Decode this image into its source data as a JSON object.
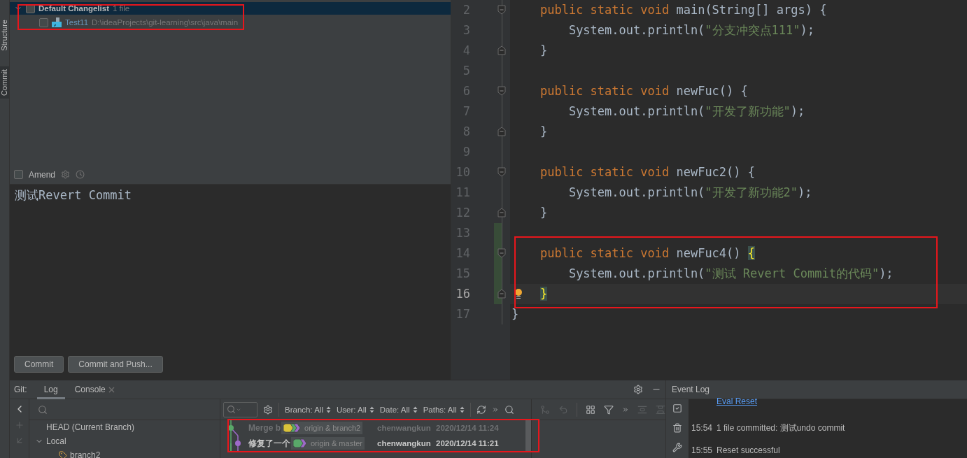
{
  "tool_strip": [
    {
      "label": "Structure",
      "selected": false
    },
    {
      "label": "Commit",
      "selected": true
    }
  ],
  "changelist": {
    "name": "Default Changelist",
    "count": "1 file",
    "expanded": true,
    "checked": false,
    "selected": true,
    "highlighted": true,
    "files": [
      {
        "name": "Test11",
        "path": "D:\\ideaProjects\\git-learning\\src\\java\\main",
        "checked": false
      }
    ]
  },
  "amend": {
    "label": "Amend",
    "checked": false
  },
  "commit_message": "测试Revert Commit",
  "commit_buttons": [
    "Commit",
    "Commit and Push..."
  ],
  "editor": {
    "lines": [
      {
        "number": "2",
        "fold_start": true,
        "fold_end": false,
        "changed": false,
        "current": false,
        "highlighted": false,
        "tokens": [
          {
            "kind": "keyword",
            "text": "    public static void"
          },
          {
            "kind": "plain",
            "text": " main(String[] args) {"
          }
        ]
      },
      {
        "number": "3",
        "fold_start": false,
        "fold_end": false,
        "changed": false,
        "current": false,
        "highlighted": false,
        "tokens": [
          {
            "kind": "plain",
            "text": "        System.out.println("
          },
          {
            "kind": "string",
            "text": "\"分支冲突点111\""
          },
          {
            "kind": "plain",
            "text": ");"
          }
        ]
      },
      {
        "number": "4",
        "fold_start": false,
        "fold_end": true,
        "changed": false,
        "current": false,
        "highlighted": false,
        "tokens": [
          {
            "kind": "plain",
            "text": "    }"
          }
        ]
      },
      {
        "number": "5",
        "fold_start": false,
        "fold_end": false,
        "changed": false,
        "current": false,
        "highlighted": false
      },
      {
        "number": "6",
        "fold_start": true,
        "fold_end": false,
        "changed": false,
        "current": false,
        "highlighted": false,
        "tokens": [
          {
            "kind": "keyword",
            "text": "    public static void"
          },
          {
            "kind": "plain",
            "text": " newFuc() {"
          }
        ]
      },
      {
        "number": "7",
        "fold_start": false,
        "fold_end": false,
        "changed": false,
        "current": false,
        "highlighted": false,
        "tokens": [
          {
            "kind": "plain",
            "text": "        System.out.println("
          },
          {
            "kind": "string",
            "text": "\"开发了新功能\""
          },
          {
            "kind": "plain",
            "text": ");"
          }
        ]
      },
      {
        "number": "8",
        "fold_start": false,
        "fold_end": true,
        "changed": false,
        "current": false,
        "highlighted": false,
        "tokens": [
          {
            "kind": "plain",
            "text": "    }"
          }
        ]
      },
      {
        "number": "9",
        "fold_start": false,
        "fold_end": false,
        "changed": false,
        "current": false,
        "highlighted": false
      },
      {
        "number": "10",
        "fold_start": true,
        "fold_end": false,
        "changed": false,
        "current": false,
        "highlighted": false,
        "tokens": [
          {
            "kind": "keyword",
            "text": "    public static void"
          },
          {
            "kind": "plain",
            "text": " newFuc2() {"
          }
        ]
      },
      {
        "number": "11",
        "fold_start": false,
        "fold_end": false,
        "changed": false,
        "current": false,
        "highlighted": false,
        "tokens": [
          {
            "kind": "plain",
            "text": "        System.out.println("
          },
          {
            "kind": "string",
            "text": "\"开发了新功能2\""
          },
          {
            "kind": "plain",
            "text": ");"
          }
        ]
      },
      {
        "number": "12",
        "fold_start": false,
        "fold_end": true,
        "changed": false,
        "current": false,
        "highlighted": false,
        "tokens": [
          {
            "kind": "plain",
            "text": "    }"
          }
        ]
      },
      {
        "number": "13",
        "fold_start": false,
        "fold_end": false,
        "changed": true,
        "current": false,
        "highlighted": false
      },
      {
        "number": "14",
        "fold_start": true,
        "fold_end": false,
        "changed": true,
        "current": false,
        "highlighted": true,
        "tokens": [
          {
            "kind": "keyword",
            "text": "    public static void"
          },
          {
            "kind": "plain",
            "text": " newFuc4() "
          },
          {
            "kind": "brace_match",
            "text": "{"
          }
        ]
      },
      {
        "number": "15",
        "fold_start": false,
        "fold_end": false,
        "changed": true,
        "current": false,
        "highlighted": true,
        "tokens": [
          {
            "kind": "plain",
            "text": "        System.out.println("
          },
          {
            "kind": "string",
            "text": "\"测试 Revert Commit的代码\""
          },
          {
            "kind": "plain",
            "text": ");"
          }
        ]
      },
      {
        "number": "16",
        "fold_start": false,
        "fold_end": true,
        "changed": true,
        "current": true,
        "highlighted": true,
        "tokens": [
          {
            "kind": "brace_match",
            "text": "    }"
          }
        ]
      },
      {
        "number": "17",
        "fold_start": false,
        "fold_end": false,
        "changed": false,
        "current": false,
        "highlighted": false,
        "tokens": [
          {
            "kind": "plain",
            "text": "}"
          }
        ]
      }
    ]
  },
  "bottom_panel": {
    "title": "Git:",
    "tabs": [
      {
        "label": "Log",
        "selected": true,
        "closable": false
      },
      {
        "label": "Console",
        "selected": false,
        "closable": true
      }
    ]
  },
  "branches": [
    {
      "label": "HEAD (Current Branch)",
      "kind": "head"
    },
    {
      "label": "Local",
      "kind": "group",
      "expanded": true,
      "children": [
        {
          "label": "branch2",
          "kind": "branch"
        }
      ]
    }
  ],
  "log_filters": [
    "Branch: All",
    "User: All",
    "Date: All",
    "Paths: All"
  ],
  "commits": [
    {
      "message": "Merge b",
      "refs": "origin & branch2",
      "tag_icons": [
        {
          "color": "#d9c23a"
        },
        {
          "color": "#59a869"
        },
        {
          "color": "#9e6ac8"
        }
      ],
      "author": "chenwangkun",
      "date": "2020/12/14 11:24",
      "current": false,
      "dimmed": true,
      "highlighted": true
    },
    {
      "message": "修复了一个",
      "refs": "origin & master",
      "tag_icons": [
        {
          "color": "#59a869"
        },
        {
          "color": "#9e6ac8"
        }
      ],
      "author": "chenwangkun",
      "date": "2020/12/14 11:21",
      "current": true,
      "dimmed": false,
      "highlighted": true
    }
  ],
  "event_log": {
    "title": "Event Log",
    "entries": [
      {
        "kind": "link",
        "text": "Eval Reset"
      },
      {
        "kind": "message",
        "time": "15:54",
        "text": "1 file committed: 测试undo commit"
      },
      {
        "kind": "message",
        "time": "15:55",
        "text": "Reset successful"
      }
    ]
  }
}
